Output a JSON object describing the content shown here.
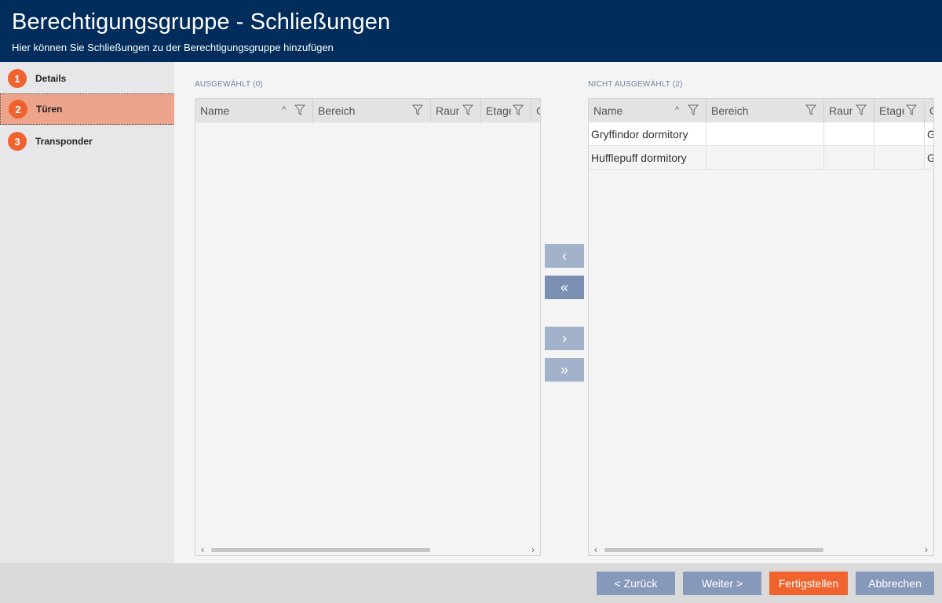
{
  "header": {
    "title": "Berechtigungsgruppe - Schließungen",
    "subtitle": "Hier können Sie Schließungen zu der Berechtigungsgruppe hinzufügen"
  },
  "steps": [
    {
      "num": "1",
      "label": "Details",
      "active": false
    },
    {
      "num": "2",
      "label": "Türen",
      "active": true
    },
    {
      "num": "3",
      "label": "Transponder",
      "active": false
    }
  ],
  "selected": {
    "label": "AUSGEWÄHLT (0)",
    "columns": [
      "Name",
      "Bereich",
      "Raum",
      "Etage",
      "G"
    ],
    "rows": []
  },
  "unselected": {
    "label": "NICHT AUSGEWÄHLT (2)",
    "columns": [
      "Name",
      "Bereich",
      "Raum",
      "Etage",
      "G"
    ],
    "rows": [
      [
        "Gryffindor dormitory",
        "",
        "",
        "",
        "G"
      ],
      [
        "Hufflepuff dormitory",
        "",
        "",
        "",
        "G"
      ]
    ]
  },
  "move_buttons": {
    "remove_one": "‹",
    "remove_all": "«",
    "add_one": "›",
    "add_all": "»"
  },
  "footer": {
    "back": "< Zurück",
    "next": "Weiter >",
    "finish": "Fertigstellen",
    "cancel": "Abbrechen"
  },
  "colors": {
    "header_bg": "#012d5c",
    "accent": "#f0632f",
    "active_step": "#eca48c",
    "button": "#8799bb"
  }
}
